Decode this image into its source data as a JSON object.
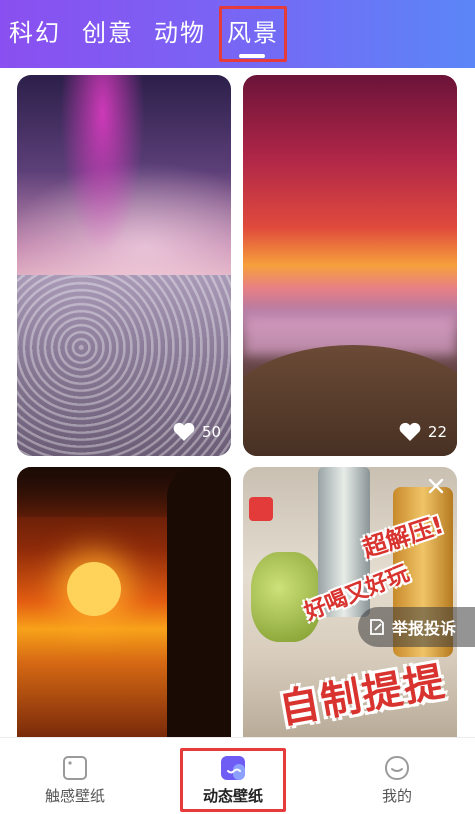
{
  "topTabs": [
    "科幻",
    "创意",
    "动物",
    "风景"
  ],
  "activeTab": "风景",
  "cards": [
    {
      "likes": "50"
    },
    {
      "likes": "22"
    }
  ],
  "reportButton": "举报投诉",
  "bottomNav": {
    "items": [
      "触感壁纸",
      "动态壁纸",
      "我的"
    ],
    "active": "动态壁纸"
  },
  "colors": {
    "topbarStart": "#8a4ff0",
    "topbarEnd": "#5b86f7",
    "highlight": "#e53b3b",
    "navActive": "#5b6cf7"
  },
  "icons": {
    "like": "heart-icon",
    "report": "report-icon",
    "close": "close-icon",
    "nav0": "touch-wallpaper-icon",
    "nav1": "dynamic-wallpaper-icon",
    "nav2": "profile-icon"
  }
}
